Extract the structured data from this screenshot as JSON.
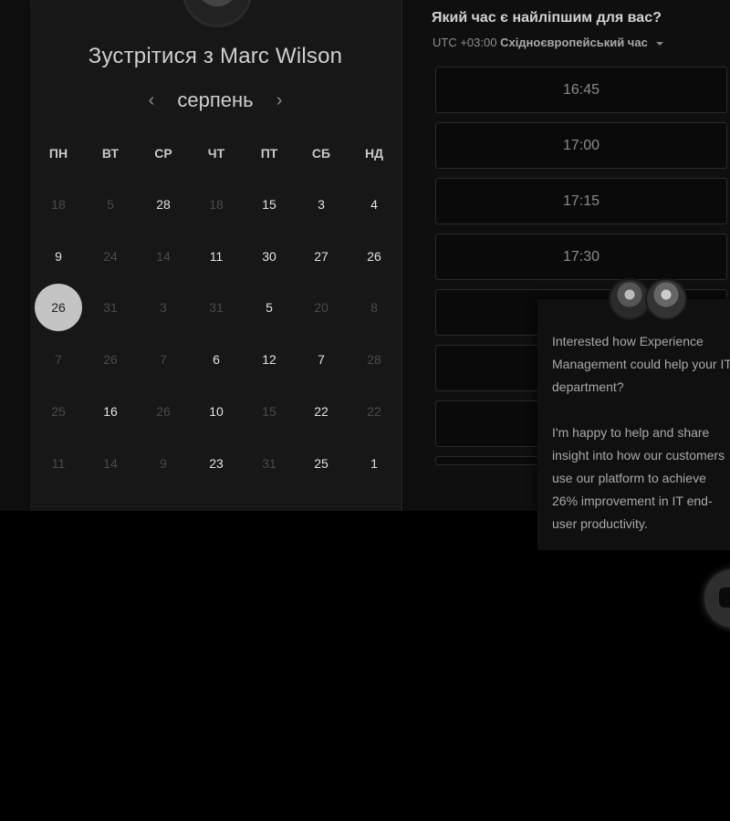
{
  "scheduler": {
    "title": "Зустрітися з Marc Wilson",
    "month": "серпень",
    "prev_icon": "chevron-left-icon",
    "next_icon": "chevron-right-icon",
    "weekdays": [
      "ПН",
      "ВТ",
      "СР",
      "ЧТ",
      "ПТ",
      "СБ",
      "НД"
    ],
    "weeks": [
      [
        {
          "d": "18",
          "on": false
        },
        {
          "d": "5",
          "on": false
        },
        {
          "d": "28",
          "on": true
        },
        {
          "d": "18",
          "on": false
        },
        {
          "d": "15",
          "on": true
        },
        {
          "d": "3",
          "on": true
        },
        {
          "d": "4",
          "on": true
        }
      ],
      [
        {
          "d": "9",
          "on": true
        },
        {
          "d": "24",
          "on": false
        },
        {
          "d": "14",
          "on": false
        },
        {
          "d": "11",
          "on": true
        },
        {
          "d": "30",
          "on": true
        },
        {
          "d": "27",
          "on": true
        },
        {
          "d": "26",
          "on": true
        }
      ],
      [
        {
          "d": "26",
          "on": true,
          "selected": true
        },
        {
          "d": "31",
          "on": false
        },
        {
          "d": "3",
          "on": false
        },
        {
          "d": "31",
          "on": false
        },
        {
          "d": "5",
          "on": true
        },
        {
          "d": "20",
          "on": false
        },
        {
          "d": "8",
          "on": false
        }
      ],
      [
        {
          "d": "7",
          "on": false
        },
        {
          "d": "26",
          "on": false
        },
        {
          "d": "7",
          "on": false
        },
        {
          "d": "6",
          "on": true
        },
        {
          "d": "12",
          "on": true
        },
        {
          "d": "7",
          "on": true
        },
        {
          "d": "28",
          "on": false
        }
      ],
      [
        {
          "d": "25",
          "on": false
        },
        {
          "d": "16",
          "on": true
        },
        {
          "d": "26",
          "on": false
        },
        {
          "d": "10",
          "on": true
        },
        {
          "d": "15",
          "on": false
        },
        {
          "d": "22",
          "on": true
        },
        {
          "d": "22",
          "on": false
        }
      ],
      [
        {
          "d": "11",
          "on": false
        },
        {
          "d": "14",
          "on": false
        },
        {
          "d": "9",
          "on": false
        },
        {
          "d": "23",
          "on": true
        },
        {
          "d": "31",
          "on": false
        },
        {
          "d": "25",
          "on": true
        },
        {
          "d": "1",
          "on": true
        }
      ]
    ]
  },
  "times": {
    "question": "Який час є найліпшим для вас?",
    "tz_offset": "UTC +03:00",
    "tz_name": "Східноєвропейський час",
    "slots": [
      "16:45",
      "17:00",
      "17:15",
      "17:30",
      "",
      "",
      "",
      ""
    ]
  },
  "chat": {
    "message": "Interested how Experience Management could help your IT department?\n\nI'm happy to help and share insight into how our customers use our platform to achieve 26% improvement in IT end-user productivity."
  },
  "colors": {
    "selected_day_bg": "#c4c4c4",
    "page_bg": "#000000",
    "panel_bg": "#171717"
  }
}
